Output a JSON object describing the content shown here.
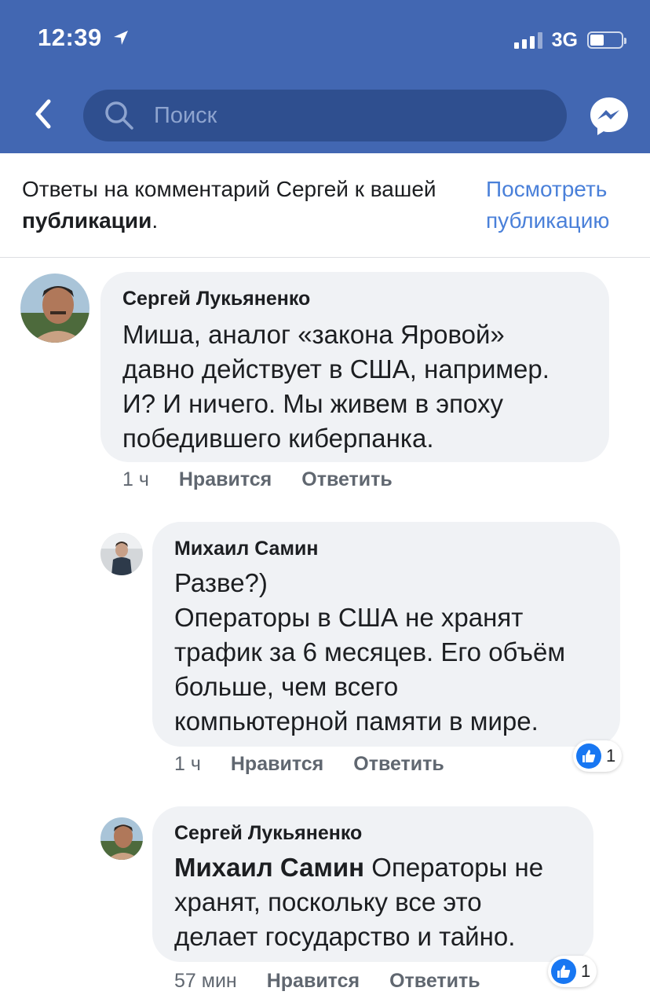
{
  "status_bar": {
    "time": "12:39",
    "network": "3G",
    "battery_level": 0.45
  },
  "nav": {
    "search_placeholder": "Поиск"
  },
  "banner": {
    "text_prefix": "Ответы на комментарий Сергей к вашей ",
    "text_bold": "публикации",
    "text_suffix": ".",
    "view_post_label": "Посмотреть публикацию"
  },
  "comments": [
    {
      "author": "Сергей Лукьяненко",
      "lines": [
        "Миша, аналог «закона Яровой»",
        "давно действует в США, например.",
        "И? И ничего. Мы живем в эпоху",
        "победившего киберпанка."
      ],
      "time": "1 ч",
      "like_label": "Нравится",
      "reply_label": "Ответить"
    },
    {
      "author": "Михаил Самин",
      "lines": [
        "Разве?)",
        "Операторы в США не хранят",
        "трафик за 6 месяцев. Его объём",
        "больше, чем всего",
        "компьютерной памяти в мире."
      ],
      "time": "1 ч",
      "like_label": "Нравится",
      "reply_label": "Ответить",
      "likes": "1"
    },
    {
      "author": "Сергей Лукьяненко",
      "mention": "Михаил Самин",
      "lines": [
        " Операторы не",
        "хранят, поскольку все это",
        "делает государство и тайно."
      ],
      "time": "57 мин",
      "like_label": "Нравится",
      "reply_label": "Ответить",
      "likes": "1"
    }
  ],
  "colors": {
    "header": "#4267b2",
    "search_box": "#2f4f8f",
    "link": "#4a80d9",
    "bubble": "#f0f2f5",
    "like_blue": "#1877f2"
  },
  "icons": [
    "location-arrow-icon",
    "signal-icon",
    "battery-icon",
    "back-chevron-icon",
    "search-icon",
    "messenger-icon",
    "like-thumb-icon"
  ]
}
